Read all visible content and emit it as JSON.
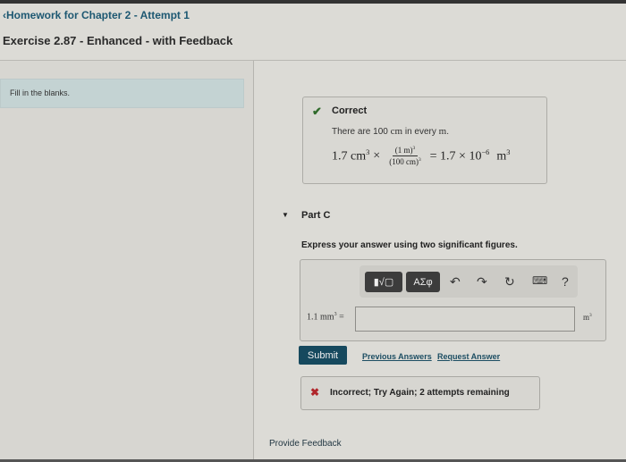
{
  "header": {
    "back_link": "Homework for Chapter 2 - Attempt 1",
    "back_icon": "chevron-left-icon",
    "exercise_title": "Exercise 2.87 - Enhanced - with Feedback"
  },
  "instructions": "Fill in the blanks.",
  "correct_feedback": {
    "status": "Correct",
    "status_icon": "check-icon",
    "explanation_prefix": "There are 100",
    "explanation_unit1": "cm",
    "explanation_mid": "in every",
    "explanation_unit2": "m",
    "explanation_suffix": ".",
    "equation": {
      "lhs": "1.7 cm",
      "lhs_exp": "3",
      "times": "×",
      "frac_num": "(1 m)",
      "frac_num_exp": "3",
      "frac_den": "(100 cm)",
      "frac_den_exp": "3",
      "equals": "= 1.7 × 10",
      "power": "−6",
      "rhs_unit": "m",
      "rhs_exp": "3"
    }
  },
  "part": {
    "title": "Part C",
    "collapse_icon": "triangle-down-icon",
    "prompt": "Express your answer using two significant figures."
  },
  "toolbar": {
    "templates_label": "▮√▢",
    "symbols_label": "ΑΣφ",
    "undo_icon": "undo-icon",
    "redo_icon": "redo-icon",
    "reset_icon": "reset-icon",
    "keyboard_icon": "keyboard-icon",
    "help_label": "?"
  },
  "answer": {
    "lhs": "1.1 mm",
    "lhs_exp": "3",
    "lhs_eq": " =",
    "value": "",
    "placeholder": "",
    "unit": "m",
    "unit_exp": "3"
  },
  "actions": {
    "submit": "Submit",
    "previous_answers": "Previous Answers",
    "request_answer": "Request Answer"
  },
  "incorrect_feedback": {
    "status_icon": "x-icon",
    "text": "Incorrect; Try Again; 2 attempts remaining"
  },
  "footer": {
    "provide_feedback": "Provide Feedback"
  },
  "colors": {
    "link": "#1d5872",
    "submit_bg": "#16495e",
    "correct_check": "#2f6a2a",
    "incorrect_x": "#b0262b",
    "instructions_bg": "#c4d3d3"
  }
}
